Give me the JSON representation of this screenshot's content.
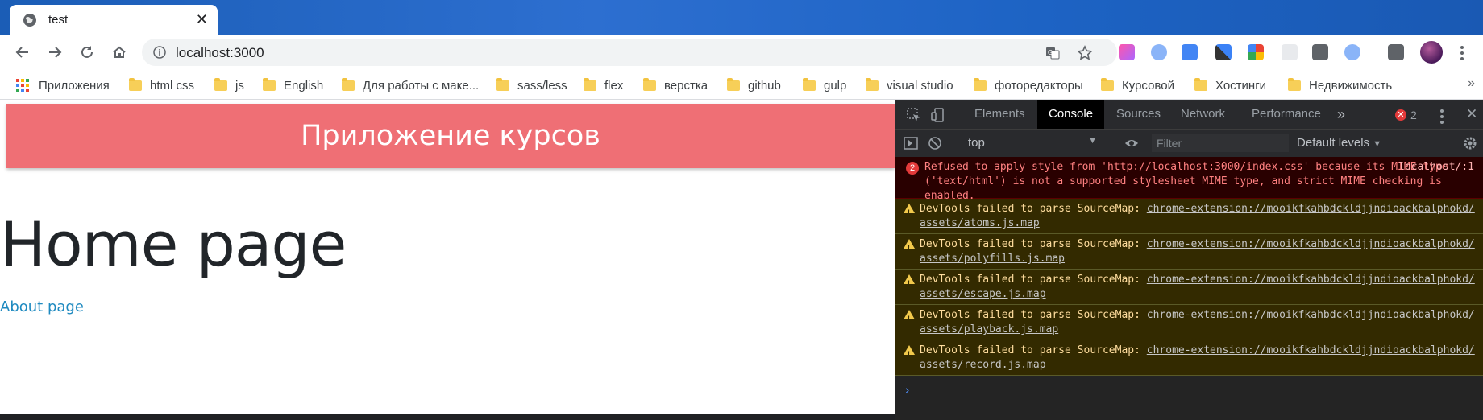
{
  "browser": {
    "tab_title": "test",
    "url": "localhost:3000",
    "bookmarks": [
      {
        "label": "Приложения",
        "icon": "apps-grid-icon"
      },
      {
        "label": "html css",
        "icon": "folder-icon"
      },
      {
        "label": "js",
        "icon": "folder-icon"
      },
      {
        "label": "English",
        "icon": "folder-icon"
      },
      {
        "label": "Для работы с маке...",
        "icon": "folder-icon"
      },
      {
        "label": "sass/less",
        "icon": "folder-icon"
      },
      {
        "label": "flex",
        "icon": "folder-icon"
      },
      {
        "label": "верстка",
        "icon": "folder-icon"
      },
      {
        "label": "github",
        "icon": "folder-icon"
      },
      {
        "label": "gulp",
        "icon": "folder-icon"
      },
      {
        "label": "visual studio",
        "icon": "folder-icon"
      },
      {
        "label": "фоторедакторы",
        "icon": "folder-icon"
      },
      {
        "label": "Курсовой",
        "icon": "folder-icon"
      },
      {
        "label": "Хостинги",
        "icon": "folder-icon"
      },
      {
        "label": "Недвижимость",
        "icon": "folder-icon"
      }
    ],
    "bookmarks_overflow": "»"
  },
  "page": {
    "header_title": "Приложение курсов",
    "heading": "Home page",
    "link": "About page",
    "header_color": "#ef6f75"
  },
  "devtools": {
    "tabs": [
      "Elements",
      "Console",
      "Sources",
      "Network",
      "Performance"
    ],
    "active_tab": "Console",
    "more_tabs": "»",
    "error_count": "2",
    "context": "top",
    "filter_placeholder": "Filter",
    "levels": "Default levels",
    "error": {
      "count": "2",
      "text_prefix": "Refused to apply style from '",
      "text_link": "http://localhost:3000/index.css",
      "text_suffix": "' because its MIME type ('text/html') is not a supported stylesheet MIME type, and strict MIME checking is enabled.",
      "source": "localhost/:1"
    },
    "warnings": [
      {
        "text": "DevTools failed to parse SourceMap: ",
        "link": "chrome-extension://mooikfkahbdckldjjndioackbalphokd/assets/atoms.js.map"
      },
      {
        "text": "DevTools failed to parse SourceMap: ",
        "link": "chrome-extension://mooikfkahbdckldjjndioackbalphokd/assets/polyfills.js.map"
      },
      {
        "text": "DevTools failed to parse SourceMap: ",
        "link": "chrome-extension://mooikfkahbdckldjjndioackbalphokd/assets/escape.js.map"
      },
      {
        "text": "DevTools failed to parse SourceMap: ",
        "link": "chrome-extension://mooikfkahbdckldjjndioackbalphokd/assets/playback.js.map"
      },
      {
        "text": "DevTools failed to parse SourceMap: ",
        "link": "chrome-extension://mooikfkahbdckldjjndioackbalphokd/assets/record.js.map"
      }
    ],
    "prompt_symbol": "›"
  }
}
